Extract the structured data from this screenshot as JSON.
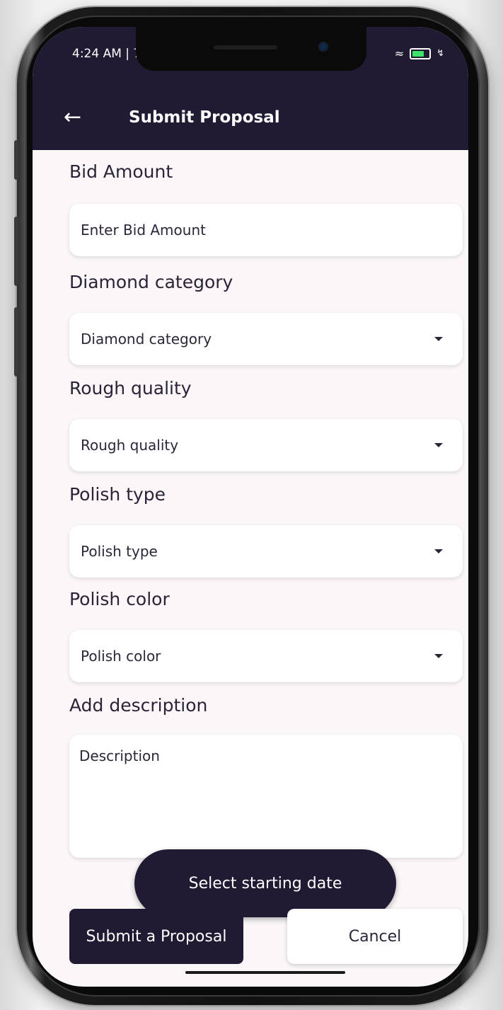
{
  "status_bar": {
    "time": "4:24 AM | 7",
    "wifi_icon": "wifi-icon",
    "battery_icon": "battery-icon",
    "battery_color": "#3ee36b"
  },
  "app_bar": {
    "back_icon": "arrow-left-icon",
    "title": "Submit Proposal",
    "background": "#211a33"
  },
  "form": {
    "bid_amount": {
      "label": "Bid Amount",
      "placeholder": "Enter Bid Amount"
    },
    "diamond_category": {
      "label": "Diamond category",
      "value": "Diamond category"
    },
    "rough_quality": {
      "label": "Rough quality",
      "value": "Rough quality"
    },
    "polish_type": {
      "label": "Polish type",
      "value": "Polish type"
    },
    "polish_color": {
      "label": "Polish color",
      "value": "Polish color"
    },
    "description": {
      "label": "Add description",
      "placeholder": "Description"
    }
  },
  "actions": {
    "select_date_label": "Select starting date",
    "submit_label": "Submit a Proposal",
    "cancel_label": "Cancel"
  }
}
